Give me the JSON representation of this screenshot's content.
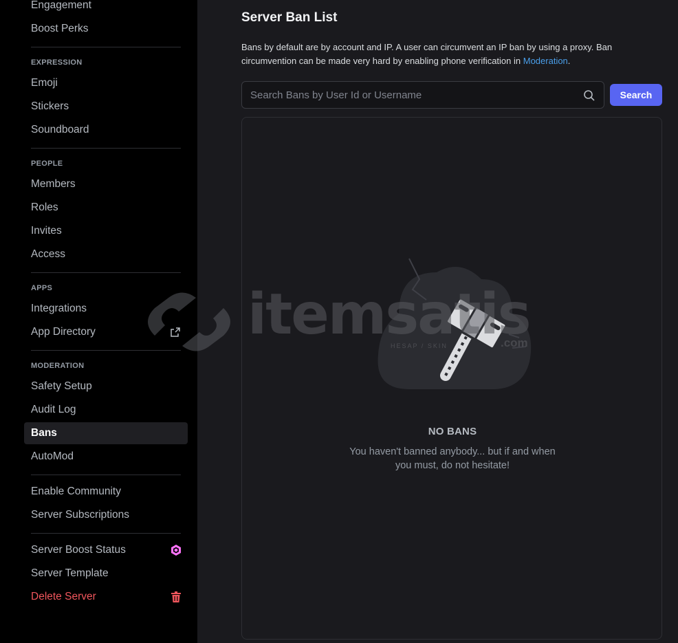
{
  "sidebar": {
    "items": {
      "engagement": "Engagement",
      "boost_perks": "Boost Perks",
      "emoji": "Emoji",
      "stickers": "Stickers",
      "soundboard": "Soundboard",
      "members": "Members",
      "roles": "Roles",
      "invites": "Invites",
      "access": "Access",
      "integrations": "Integrations",
      "app_directory": "App Directory",
      "safety_setup": "Safety Setup",
      "audit_log": "Audit Log",
      "bans": "Bans",
      "automod": "AutoMod",
      "enable_community": "Enable Community",
      "server_subscriptions": "Server Subscriptions",
      "server_boost_status": "Server Boost Status",
      "server_template": "Server Template",
      "delete_server": "Delete Server"
    },
    "sections": {
      "expression": "EXPRESSION",
      "people": "PEOPLE",
      "apps": "APPS",
      "moderation": "MODERATION"
    },
    "active_item": "Bans",
    "icons": {
      "app_directory": "external-link-icon",
      "server_boost_status": "boost-gem-icon",
      "delete_server": "trash-icon"
    }
  },
  "main": {
    "title": "Server Ban List",
    "description_text": "Bans by default are by account and IP. A user can circumvent an IP ban by using a proxy. Ban circumvention can be made very hard by enabling phone verification in ",
    "description_link": "Moderation",
    "description_end": ".",
    "search": {
      "placeholder": "Search Bans by User Id or Username",
      "value": "",
      "button_label": "Search"
    },
    "empty_state": {
      "title": "NO BANS",
      "description": "You haven't banned anybody... but if and when you must, do not hesitate!"
    }
  },
  "watermark": {
    "text": "itemsatis",
    "subtext": "HESAP / SKIN",
    "suffix": ".com"
  },
  "colors": {
    "accent": "#5865f2",
    "link": "#4a9fea",
    "danger": "#f0565c",
    "boost": "#ff73fa",
    "sidebar_bg": "#000000",
    "main_bg": "#1a1a1e"
  }
}
